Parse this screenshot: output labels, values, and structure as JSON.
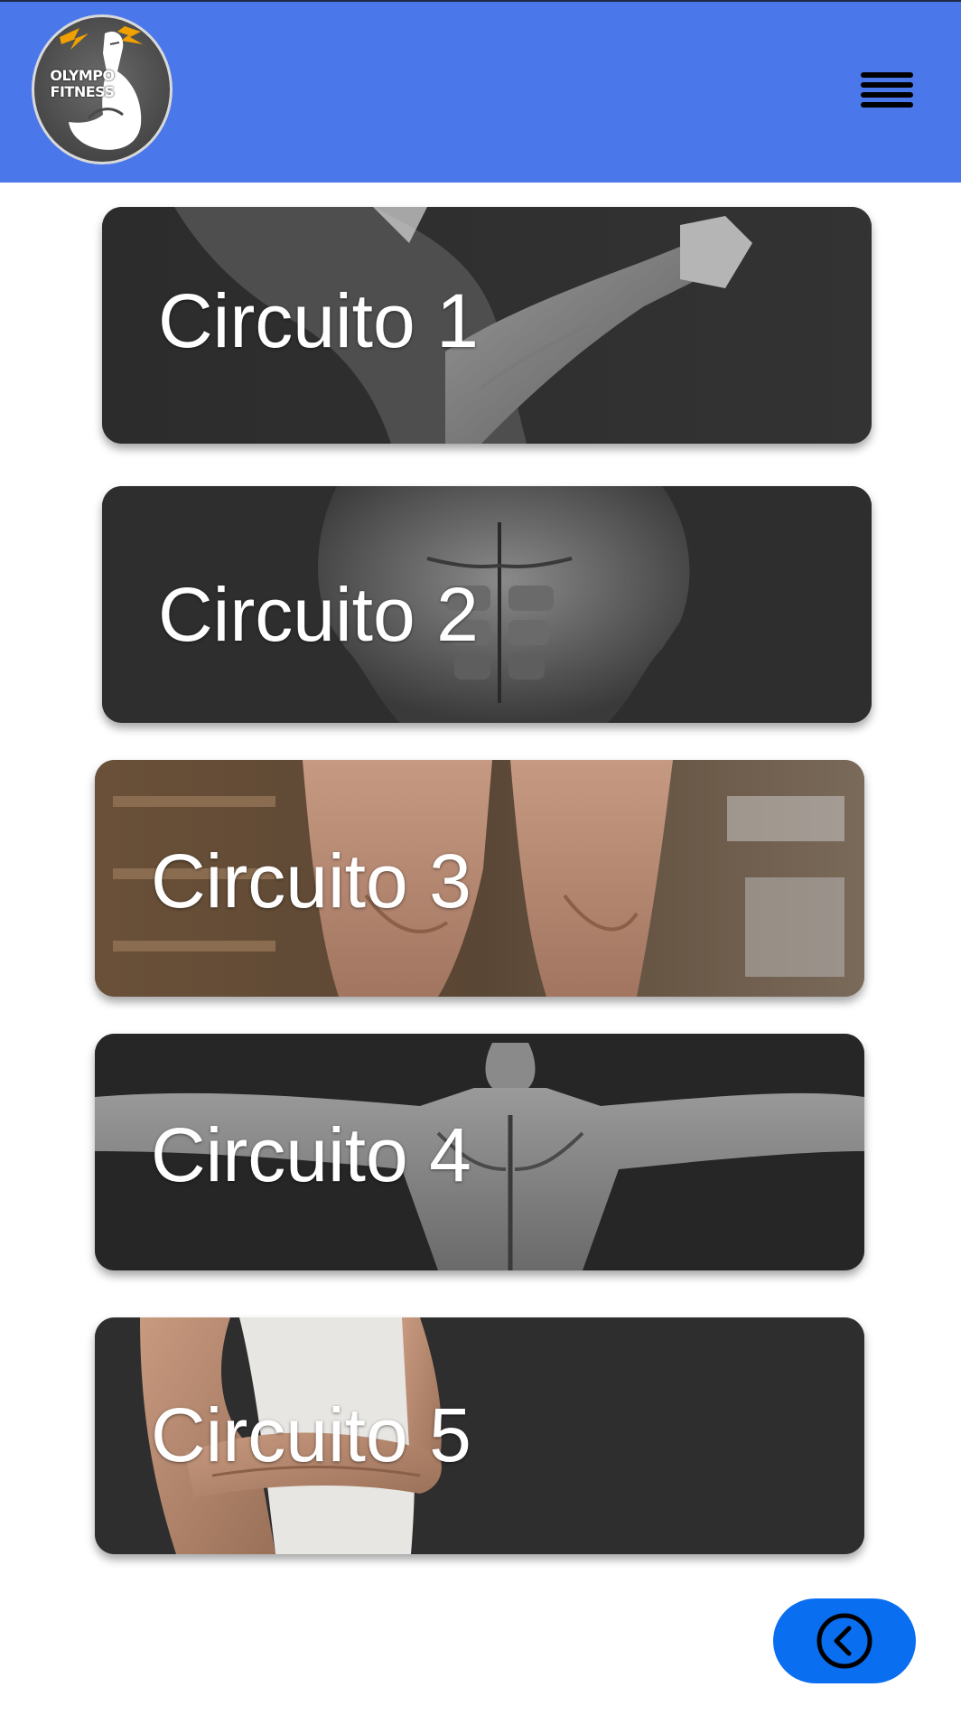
{
  "header": {
    "logo_text": "OLYMPO FITNESS",
    "accent_color": "#4a77ea",
    "menu_icon": "hamburger-menu-icon"
  },
  "circuits": [
    {
      "label": "Circuito 1",
      "image": "muscular-arm-bw"
    },
    {
      "label": "Circuito 2",
      "image": "torso-abs-bw"
    },
    {
      "label": "Circuito 3",
      "image": "legs-quads-color"
    },
    {
      "label": "Circuito 4",
      "image": "back-spread-bw"
    },
    {
      "label": "Circuito 5",
      "image": "crossed-arms-tank-top"
    }
  ],
  "footer": {
    "back_icon": "chevron-left-circle-icon",
    "back_color": "#0a6ef0"
  }
}
